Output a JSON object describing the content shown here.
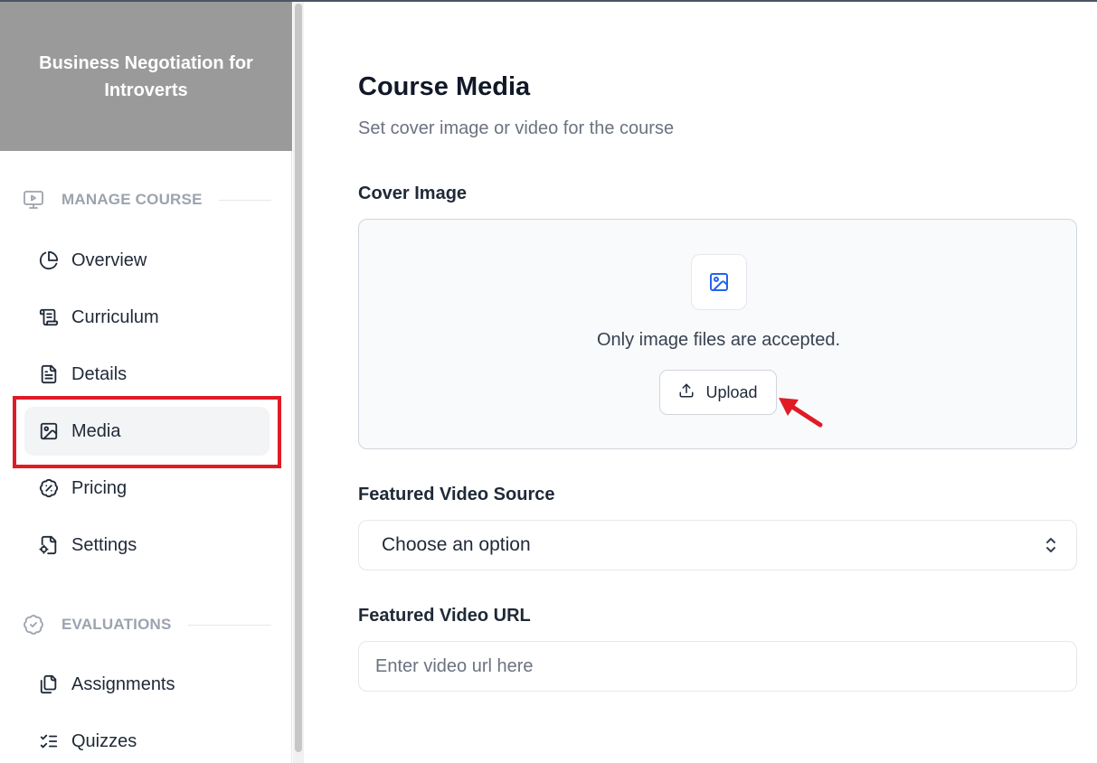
{
  "sidebar": {
    "course_title": "Business Negotiation for Introverts",
    "sections": [
      {
        "label": "MANAGE COURSE",
        "icon": "presentation-icon"
      },
      {
        "label": "EVALUATIONS",
        "icon": "badge-check-icon"
      }
    ],
    "items": [
      {
        "label": "Overview",
        "icon": "pie-chart-icon"
      },
      {
        "label": "Curriculum",
        "icon": "scroll-icon"
      },
      {
        "label": "Details",
        "icon": "file-text-icon"
      },
      {
        "label": "Media",
        "icon": "image-icon",
        "active": true
      },
      {
        "label": "Pricing",
        "icon": "discount-badge-icon"
      },
      {
        "label": "Settings",
        "icon": "file-cog-icon"
      },
      {
        "label": "Assignments",
        "icon": "files-icon"
      },
      {
        "label": "Quizzes",
        "icon": "list-checks-icon"
      }
    ]
  },
  "main": {
    "title": "Course Media",
    "subtitle": "Set cover image or video for the course",
    "cover_image": {
      "label": "Cover Image",
      "hint": "Only image files are accepted.",
      "upload_label": "Upload"
    },
    "video_source": {
      "label": "Featured Video Source",
      "value": "Choose an option"
    },
    "video_url": {
      "label": "Featured Video URL",
      "placeholder": "Enter video url here",
      "value": ""
    }
  },
  "colors": {
    "header_bg": "#9a9a9a",
    "highlight": "#e01b24",
    "accent_icon": "#2563eb",
    "active_bg": "#f3f4f6"
  }
}
